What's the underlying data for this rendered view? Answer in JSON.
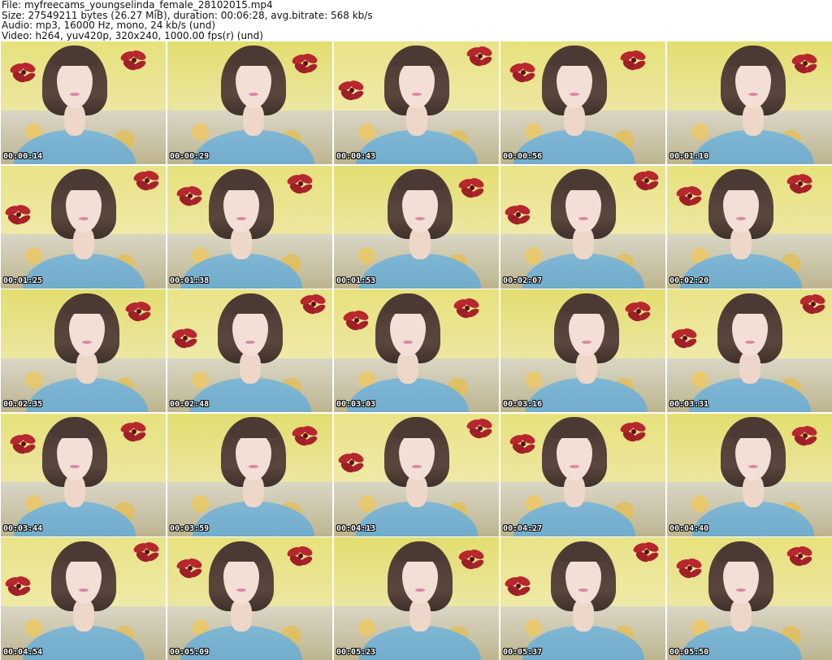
{
  "header": {
    "file": "File: myfreecams_youngselinda_female_28102015.mp4",
    "size": "Size: 27549211 bytes (26.27 MiB), duration: 00:06:28, avg.bitrate: 568 kb/s",
    "audio": "Audio: mp3, 16000 Hz, mono, 24 kb/s (und)",
    "video": "Video: h264, yuv420p, 320x240, 1000.00 fps(r) (und)"
  },
  "thumbnails": [
    {
      "time": "00:00:14"
    },
    {
      "time": "00:00:29"
    },
    {
      "time": "00:00:43"
    },
    {
      "time": "00:00:56"
    },
    {
      "time": "00:01:10"
    },
    {
      "time": "00:01:25"
    },
    {
      "time": "00:01:38"
    },
    {
      "time": "00:01:53"
    },
    {
      "time": "00:02:07"
    },
    {
      "time": "00:02:20"
    },
    {
      "time": "00:02:35"
    },
    {
      "time": "00:02:48"
    },
    {
      "time": "00:03:03"
    },
    {
      "time": "00:03:16"
    },
    {
      "time": "00:03:31"
    },
    {
      "time": "00:03:44"
    },
    {
      "time": "00:03:59"
    },
    {
      "time": "00:04:13"
    },
    {
      "time": "00:04:27"
    },
    {
      "time": "00:04:40"
    },
    {
      "time": "00:04:54"
    },
    {
      "time": "00:05:09"
    },
    {
      "time": "00:05:23"
    },
    {
      "time": "00:05:37"
    },
    {
      "time": "00:05:50"
    }
  ],
  "colors": {
    "wall_yellow": "#e6e07a",
    "wall_light": "#efe9a0",
    "flower_red": "#b8262e",
    "shirt_blue": "#7fb7d4",
    "timestamp_text": "#ffffff"
  }
}
